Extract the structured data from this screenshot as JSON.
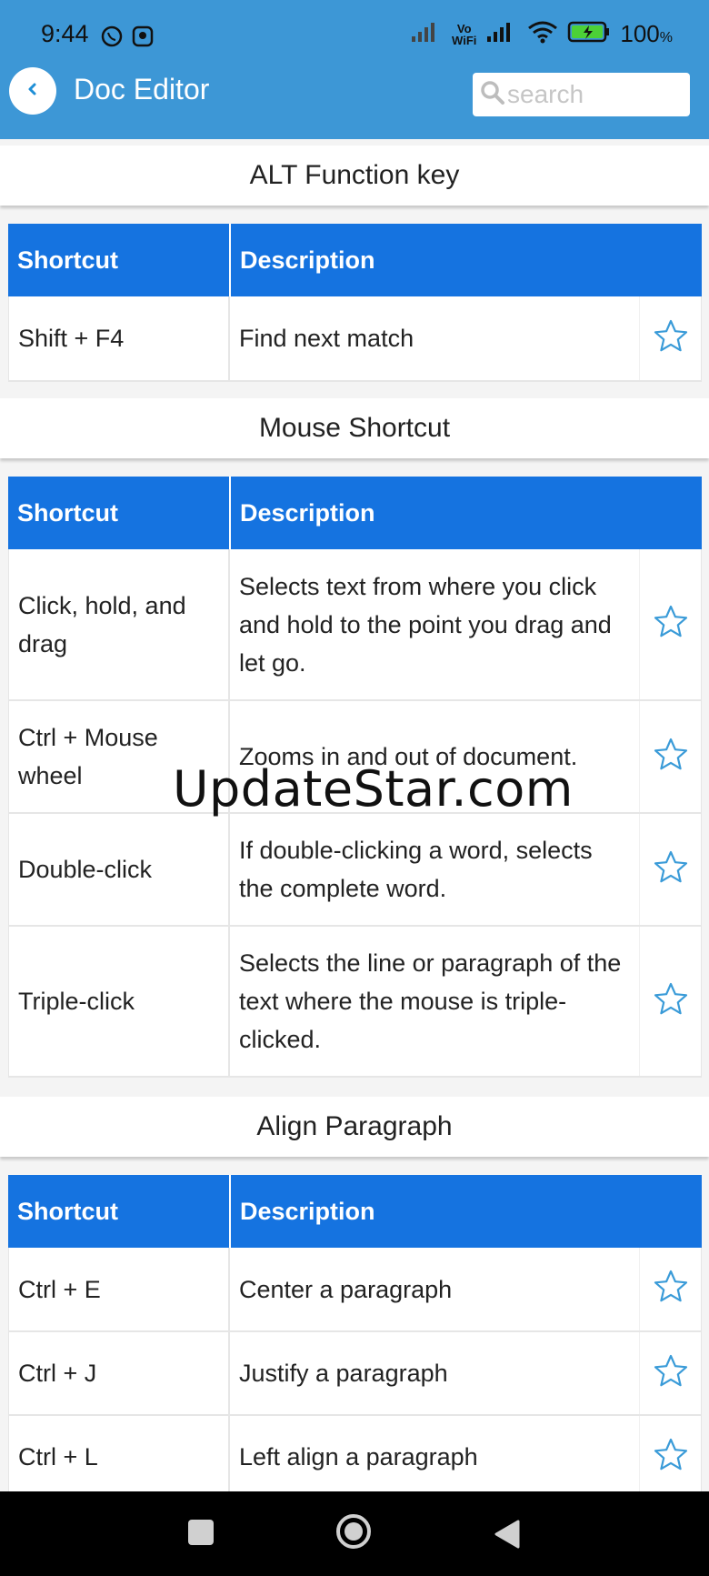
{
  "status_bar": {
    "time": "9:44",
    "battery_percent": "100"
  },
  "header": {
    "title": "Doc Editor",
    "search_placeholder": "search"
  },
  "columns": {
    "shortcut": "Shortcut",
    "description": "Description"
  },
  "sections": [
    {
      "title": "ALT Function key",
      "rows": [
        {
          "shortcut": "Shift + F4",
          "description": "Find next match"
        }
      ]
    },
    {
      "title": "Mouse Shortcut",
      "rows": [
        {
          "shortcut": "Click, hold, and drag",
          "description": "Selects text from where you click and hold to the point you drag and let go."
        },
        {
          "shortcut": "Ctrl + Mouse wheel",
          "description": "Zooms in and out of document."
        },
        {
          "shortcut": "Double-click",
          "description": "If double-clicking a word, selects the complete word."
        },
        {
          "shortcut": "Triple-click",
          "description": "Selects the line or paragraph of the text where the mouse is triple-clicked."
        }
      ]
    },
    {
      "title": "Align Paragraph",
      "rows": [
        {
          "shortcut": "Ctrl + E",
          "description": "Center a paragraph"
        },
        {
          "shortcut": "Ctrl + J",
          "description": "Justify a paragraph"
        },
        {
          "shortcut": "Ctrl + L",
          "description": "Left align a paragraph"
        }
      ]
    }
  ],
  "watermark": "UpdateStar.com",
  "colors": {
    "header_bg": "#3d97d6",
    "table_header_bg": "#1573e0",
    "star_outline": "#3a9bd8"
  }
}
